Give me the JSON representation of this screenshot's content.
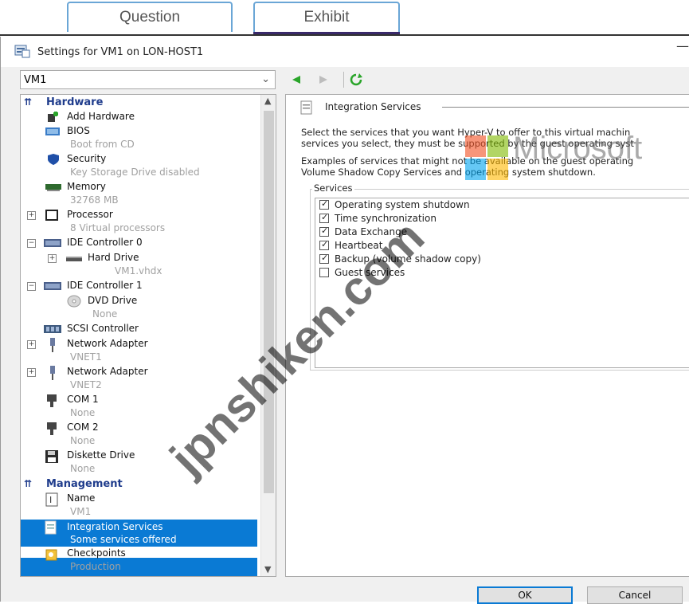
{
  "top_tabs": {
    "question": "Question",
    "exhibit": "Exhibit"
  },
  "window": {
    "title": "Settings for VM1 on LON-HOST1",
    "minimize": "—"
  },
  "vm_select": {
    "value": "VM1"
  },
  "tree": {
    "hardware_header": "Hardware",
    "management_header": "Management",
    "items": [
      {
        "label": "Add Hardware",
        "sub": ""
      },
      {
        "label": "BIOS",
        "sub": "Boot from CD"
      },
      {
        "label": "Security",
        "sub": "Key Storage Drive disabled"
      },
      {
        "label": "Memory",
        "sub": "32768 MB"
      },
      {
        "label": "Processor",
        "sub": "8 Virtual processors"
      },
      {
        "label": "IDE Controller 0",
        "sub": ""
      },
      {
        "label": "Hard Drive",
        "sub": "VM1.vhdx"
      },
      {
        "label": "IDE Controller 1",
        "sub": ""
      },
      {
        "label": "DVD Drive",
        "sub": "None"
      },
      {
        "label": "SCSI Controller",
        "sub": ""
      },
      {
        "label": "Network Adapter",
        "sub": "VNET1"
      },
      {
        "label": "Network Adapter",
        "sub": "VNET2"
      },
      {
        "label": "COM 1",
        "sub": "None"
      },
      {
        "label": "COM 2",
        "sub": "None"
      },
      {
        "label": "Diskette Drive",
        "sub": "None"
      },
      {
        "label": "Name",
        "sub": "VM1"
      },
      {
        "label": "Integration Services",
        "sub": "Some services offered"
      },
      {
        "label": "Checkpoints",
        "sub": "Production"
      }
    ]
  },
  "panel": {
    "header": "Integration Services",
    "desc1": "Select the services that you want Hyper-V to offer to this virtual machin",
    "desc2": "services you select, they must be supported by the guest operating syst",
    "desc3": "Examples of services that might not be available on the guest operating",
    "desc4": "Volume Shadow Copy Services and operating system shutdown.",
    "services_label": "Services",
    "services": [
      {
        "label": "Operating system shutdown",
        "checked": true
      },
      {
        "label": "Time synchronization",
        "checked": true
      },
      {
        "label": "Data Exchange",
        "checked": true
      },
      {
        "label": "Heartbeat",
        "checked": true
      },
      {
        "label": "Backup (volume shadow copy)",
        "checked": true
      },
      {
        "label": "Guest services",
        "checked": false
      }
    ]
  },
  "buttons": {
    "ok": "OK",
    "cancel": "Cancel"
  },
  "watermarks": {
    "site": "jpnshiken.com",
    "brand": "Microsoft"
  },
  "colors": {
    "selection": "#0a7ad4",
    "header": "#1f3c8c",
    "nav_green": "#2aa52a"
  }
}
